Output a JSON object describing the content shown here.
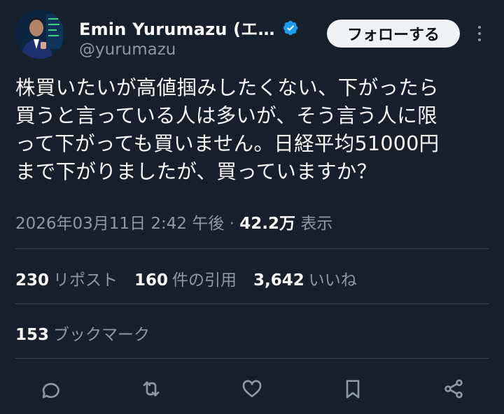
{
  "author": {
    "display_name": "Emin Yurumazu (エ…",
    "handle": "@yurumazu",
    "verified": true
  },
  "header": {
    "follow_label": "フォローする"
  },
  "tweet": {
    "text": "株買いたいが高値掴みしたくない、下がったら\n買うと言っている人は多いが、そう言う人に限\nって下がっても買いません。日経平均51000円\nまで下がりましたが、買っていますか？",
    "timestamp": "2026年03月11日 2:42 午後",
    "separator": "·",
    "views_count": "42.2万",
    "views_label": "表示"
  },
  "stats": {
    "reposts_count": "230",
    "reposts_label": "リポスト",
    "quotes_count": "160",
    "quotes_label": "件の引用",
    "likes_count": "3,642",
    "likes_label": "いいね",
    "bookmarks_count": "153",
    "bookmarks_label": "ブックマーク"
  },
  "actions": [
    "reply-icon",
    "repost-icon",
    "like-icon",
    "bookmark-icon",
    "share-icon"
  ],
  "colors": {
    "background": "#15202b",
    "text_primary": "#f7f9f9",
    "text_secondary": "#8b98a5",
    "verified_blue": "#1d9bf0",
    "divider": "#38444d"
  }
}
